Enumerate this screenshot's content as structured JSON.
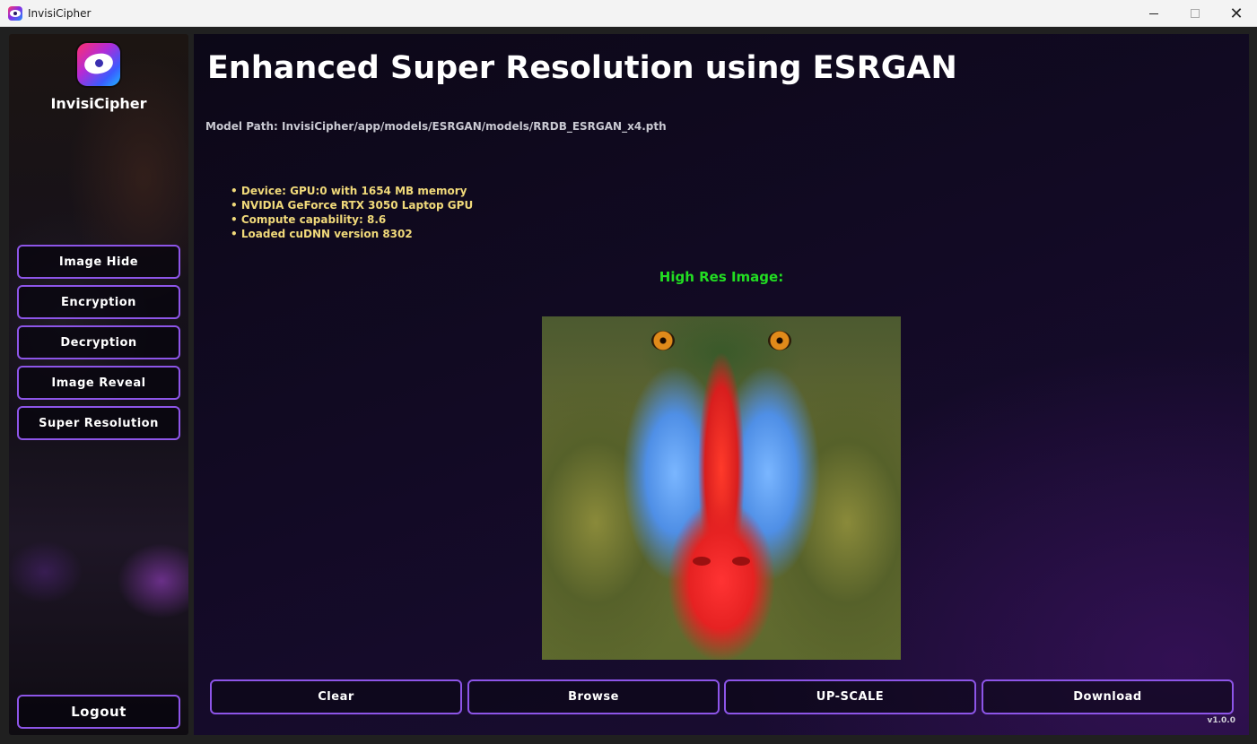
{
  "window": {
    "title": "InvisiCipher",
    "controls": {
      "minimize_icon": "minimize-icon",
      "maximize_icon": "maximize-icon",
      "close_icon": "close-icon",
      "close_glyph": "✕"
    }
  },
  "sidebar": {
    "brand": "InvisiCipher",
    "logo_icon": "eye-logo-icon",
    "items": [
      {
        "label": "Image Hide"
      },
      {
        "label": "Encryption"
      },
      {
        "label": "Decryption"
      },
      {
        "label": "Image Reveal"
      },
      {
        "label": "Super Resolution"
      }
    ],
    "logout_label": "Logout"
  },
  "main": {
    "title": "Enhanced Super Resolution using ESRGAN",
    "model_path": "Model Path: InvisiCipher/app/models/ESRGAN/models/RRDB_ESRGAN_x4.pth",
    "device_info": [
      "Device: GPU:0 with 1654 MB memory",
      "NVIDIA GeForce RTX 3050 Laptop GPU",
      "Compute capability: 8.6",
      "Loaded cuDNN version 8302"
    ],
    "image_label": "High Res Image:",
    "buttons": {
      "clear": "Clear",
      "browse": "Browse",
      "upscale": "UP-SCALE",
      "download": "Download"
    },
    "version": "v1.0.0"
  },
  "colors": {
    "accent_border": "#8d55e8",
    "label_green": "#22dd22",
    "info_yellow": "#f0d97a"
  }
}
